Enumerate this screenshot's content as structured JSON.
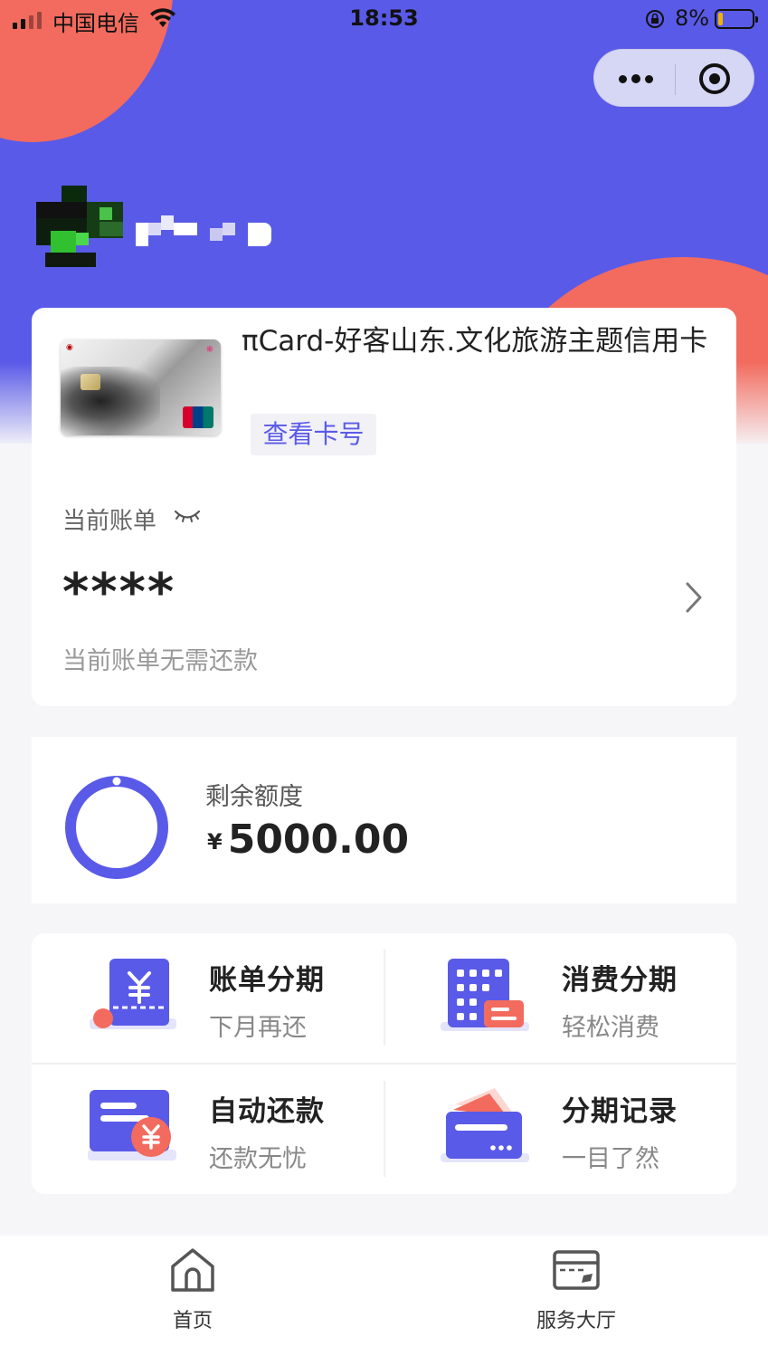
{
  "status_bar": {
    "carrier": "中国电信",
    "time": "18:53",
    "battery_percent": "8%",
    "battery_level": 0.08
  },
  "capsule": {
    "more_icon": "more-dots-icon",
    "close_icon": "target-circle-icon"
  },
  "card": {
    "name": "πCard-好客山东.文化旅游主题信用卡",
    "view_number_button": "查看卡号"
  },
  "bill": {
    "label": "当前账单",
    "amount_masked": "****",
    "note": "当前账单无需还款"
  },
  "credit": {
    "label": "剩余额度",
    "currency": "¥",
    "amount": "5000.00",
    "ring_fraction": 1.0
  },
  "services": [
    {
      "title": "账单分期",
      "subtitle": "下月再还",
      "icon": "bill-yen-icon"
    },
    {
      "title": "消费分期",
      "subtitle": "轻松消费",
      "icon": "calculator-icon"
    },
    {
      "title": "自动还款",
      "subtitle": "还款无忧",
      "icon": "auto-repay-icon"
    },
    {
      "title": "分期记录",
      "subtitle": "一目了然",
      "icon": "wallet-cards-icon"
    }
  ],
  "tabbar": [
    {
      "label": "首页",
      "icon": "home-icon"
    },
    {
      "label": "服务大厅",
      "icon": "service-card-icon"
    }
  ],
  "colors": {
    "primary": "#5a5ae8",
    "accent": "#f26b5e",
    "background": "#f6f6f9"
  }
}
